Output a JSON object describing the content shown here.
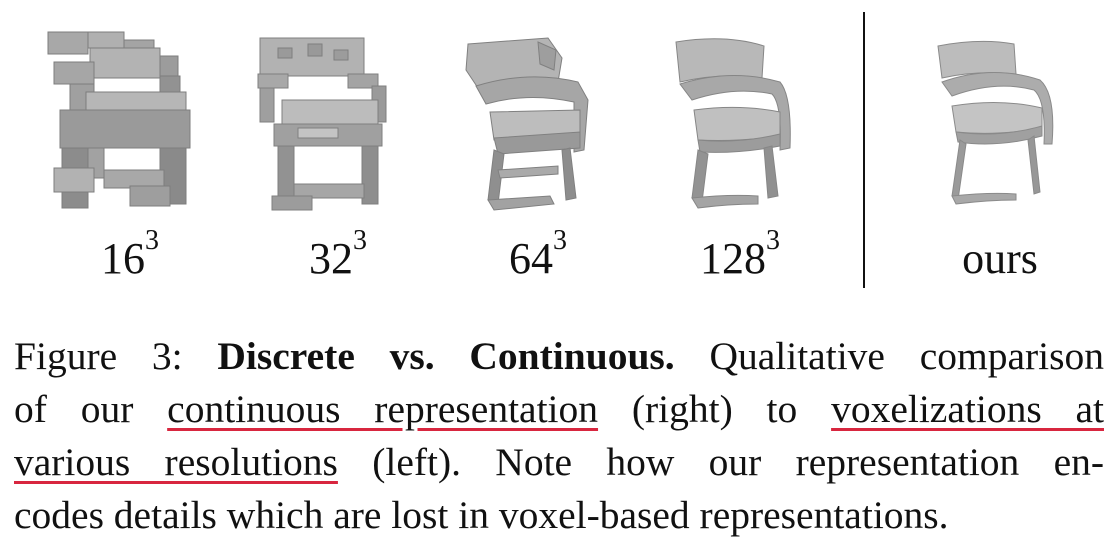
{
  "panels": [
    {
      "base": "16",
      "exp": "3"
    },
    {
      "base": "32",
      "exp": "3"
    },
    {
      "base": "64",
      "exp": "3"
    },
    {
      "base": "128",
      "exp": "3"
    },
    {
      "label": "ours"
    }
  ],
  "caption": {
    "label": "Figure 3:",
    "title": "Discrete vs. Continuous.",
    "l1_rest": "Qualitative comparison",
    "l2_a": "of our",
    "l2_u1": "continuous representation",
    "l2_b": "(right) to",
    "l2_u2": "voxelizations at",
    "l3_u": "various resolutions",
    "l3_b": "(left).  Note how our representation en-",
    "l4": "codes details which are lost in voxel-based representations."
  },
  "colors": {
    "underline": "#d8263f",
    "chair": "#9a9a9a"
  }
}
